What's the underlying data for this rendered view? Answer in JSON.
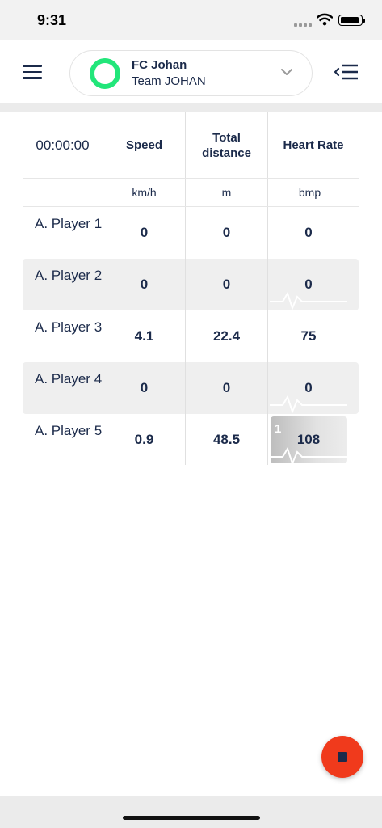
{
  "status_bar": {
    "time": "9:31"
  },
  "header": {
    "team_name": "FC Johan",
    "team_subtitle": "Team JOHAN",
    "ring_color": "#22e67a"
  },
  "table": {
    "timer": "00:00:00",
    "columns": [
      {
        "label": "Speed",
        "unit": "km/h"
      },
      {
        "label": "Total distance",
        "unit": "m"
      },
      {
        "label": "Heart Rate",
        "unit": "bmp"
      }
    ],
    "rows": [
      {
        "player": "A. Player 1",
        "speed": "0",
        "distance": "0",
        "heart_rate": "0"
      },
      {
        "player": "A. Player 2",
        "speed": "0",
        "distance": "0",
        "heart_rate": "0"
      },
      {
        "player": "A. Player 3",
        "speed": "4.1",
        "distance": "22.4",
        "heart_rate": "75"
      },
      {
        "player": "A. Player 4",
        "speed": "0",
        "distance": "0",
        "heart_rate": "0"
      },
      {
        "player": "A. Player 5",
        "speed": "0.9",
        "distance": "48.5",
        "heart_rate": "108",
        "hr_zone": "1"
      }
    ]
  },
  "colors": {
    "accent": "#1b2a4a",
    "stop_button": "#f03a1c"
  },
  "icons": [
    "menu-icon",
    "chevron-down-icon",
    "collapse-menu-icon",
    "heartbeat-icon",
    "stop-icon"
  ]
}
